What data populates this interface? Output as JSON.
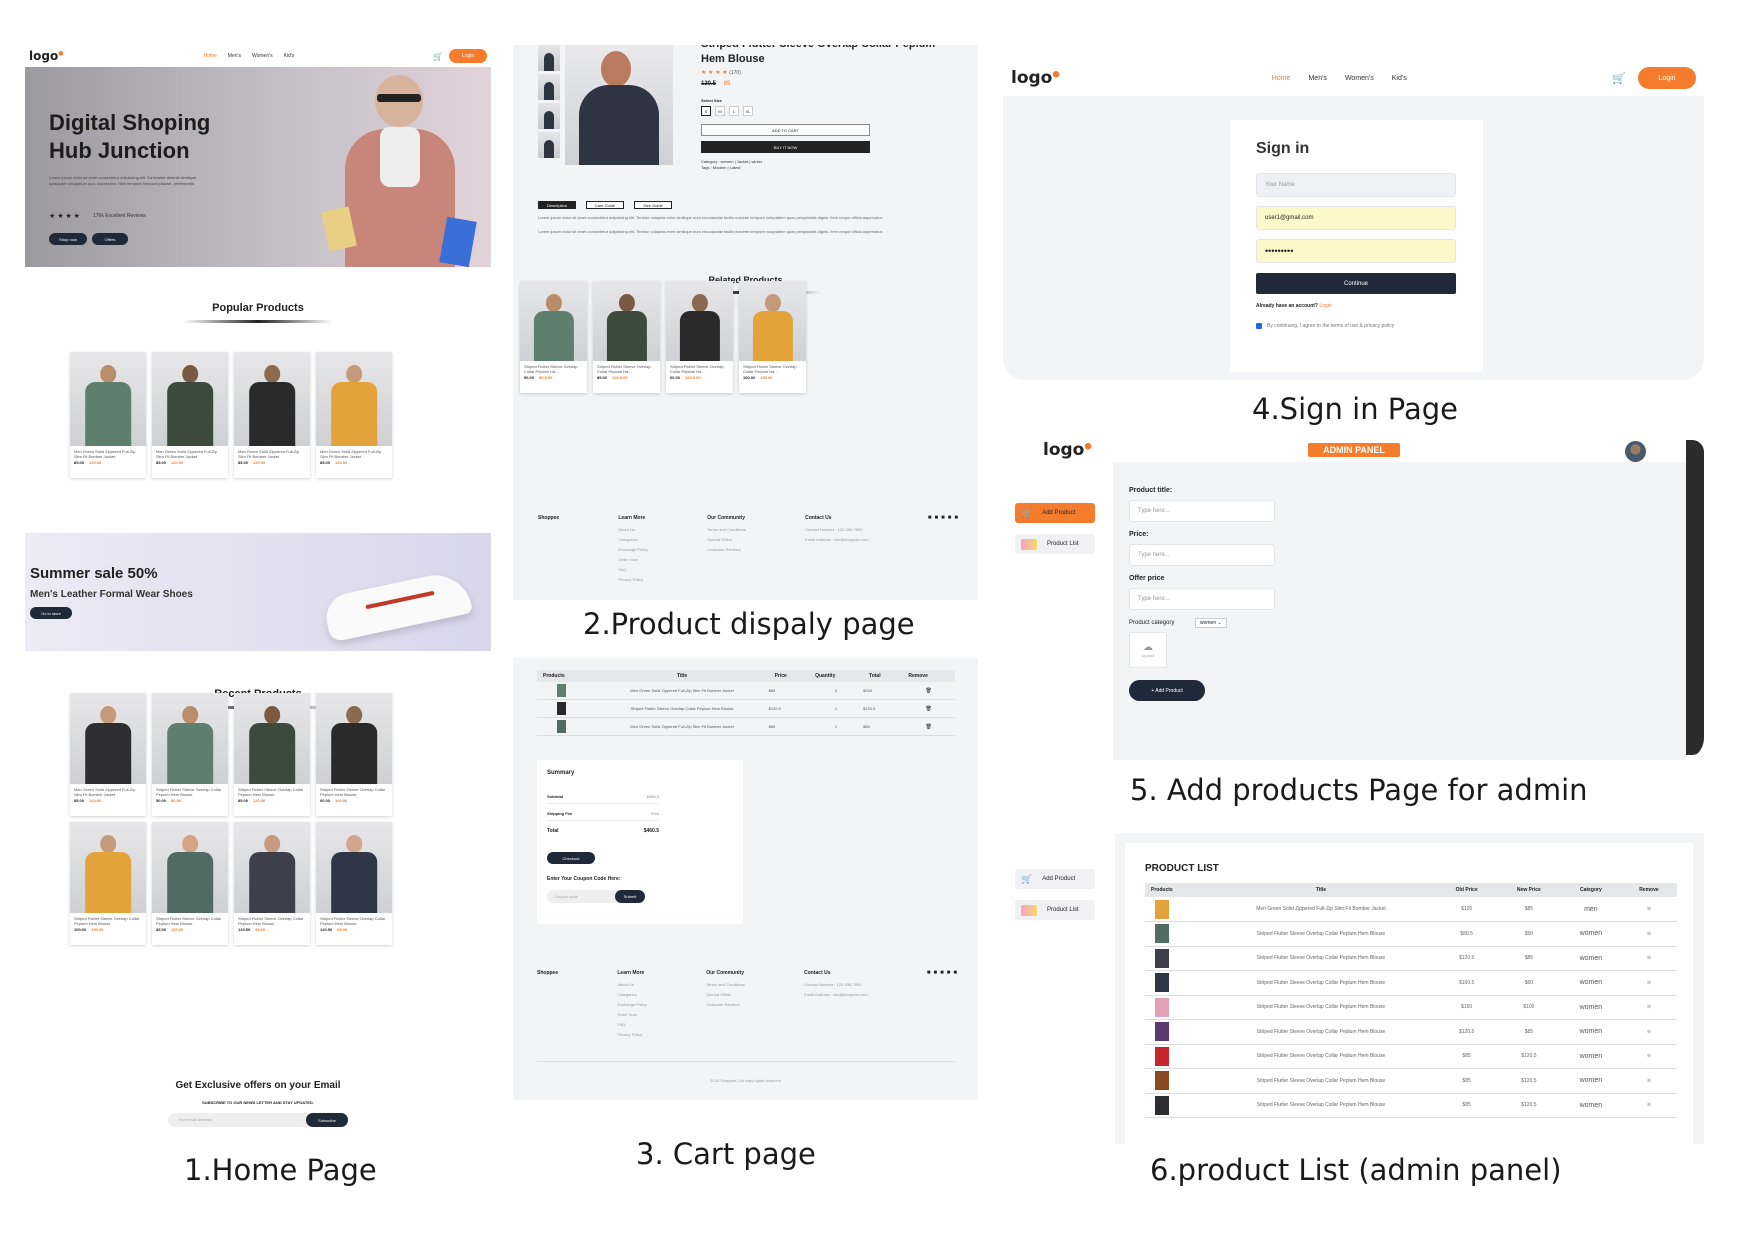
{
  "captions": {
    "home": "1.Home Page",
    "product": "2.Product dispaly page",
    "cart": "3. Cart page",
    "signin": "4.Sign in Page",
    "addproduct": "5. Add products Page for admin",
    "productlist": "6.product List (admin panel)"
  },
  "logo": "logo",
  "nav": [
    "Home",
    "Men's",
    "Women's",
    "Kid's"
  ],
  "login": "Login",
  "cart_count": "0",
  "home": {
    "hero_title": "Digital Shoping Hub Junction",
    "hero_text": "Lorem ipsum dolor sit amet consectetur adipisicing elit. Ea tenetur deleniti similique quisquam voluptatum quo, aspernatur. Nihil tempore tempora placeat, perferendis.",
    "reviews": "176k Excellent Reviews",
    "shop_now": "Shop now",
    "offers": "Offers",
    "popular_title": "Popular Products",
    "popular": [
      {
        "name": "Men Green Solid Zippered Full-Zip Slim Fit Bomber Jacket",
        "new": "85.00",
        "old": "120.00"
      },
      {
        "name": "Men Green Solid Zippered Full-Zip Slim Fit Bomber Jacket",
        "new": "85.00",
        "old": "120.00"
      },
      {
        "name": "Men Green Solid Zippered Full-Zip Slim Fit Bomber Jacket",
        "new": "85.00",
        "old": "120.00"
      },
      {
        "name": "Men Green Solid Zippered Full-Zip Slim Fit Bomber Jacket",
        "new": "85.00",
        "old": "120.00"
      }
    ],
    "sale_title": "Summer sale 50%",
    "sale_sub": "Men's Leather Formal Wear Shoes",
    "go_store": "Go to store",
    "recent_title": "Recent Products",
    "recent": [
      {
        "name": "Men Green Solid Zippered Full-Zip Slim Fit Bomber Jacket",
        "new": "85.00",
        "old": "120.00"
      },
      {
        "name": "Striped Flutter Sleeve Overlap Collar Peplum Hem Blouse",
        "new": "50.00",
        "old": "80.00"
      },
      {
        "name": "Striped Flutter Sleeve Overlap Collar Peplum Hem Blouse",
        "new": "85.00",
        "old": "120.50"
      },
      {
        "name": "Striped Flutter Sleeve Overlap Collar Peplum Hem Blouse",
        "new": "60.00",
        "old": "100.50"
      },
      {
        "name": "Striped Flutter Sleeve Overlap Collar Peplum Hem Blouse",
        "new": "100.00",
        "old": "150.00"
      },
      {
        "name": "Striped Flutter Sleeve Overlap Collar Peplum Hem Blouse",
        "new": "85.00",
        "old": "120.00"
      },
      {
        "name": "Striped Flutter Sleeve Overlap Collar Peplum Hem Blouse",
        "new": "120.50",
        "old": "85.00"
      },
      {
        "name": "Striped Flutter Sleeve Overlap Collar Peplum Hem Blouse",
        "new": "120.50",
        "old": "85.00"
      }
    ],
    "newsletter_title": "Get Exclusive offers on your Email",
    "newsletter_sub": "SUBSCRIBE TO OUR NEWS LETTER AND STAY UPDATED.",
    "email_placeholder": "Your email address",
    "subscribe": "Subscribe"
  },
  "product": {
    "title": "Striped Flutter Sleeve Overlap Collar Peplum Hem Blouse",
    "rating_count": "(170)",
    "old_price": "120.5",
    "new_price": "85",
    "select_size": "Select Size",
    "sizes": [
      "S",
      "M",
      "L",
      "XL"
    ],
    "add_to_cart": "ADD TO CART",
    "buy_now": "BUY IT NOW",
    "category": "Category : women | Jacket | winter",
    "tags": "Tags : Modern | Latest",
    "tabs": [
      "Description",
      "Care Guide",
      "Size Guide"
    ],
    "desc": "Lorem ipsum dolor sit amet consectetur adipisicing elit. Tenetur voluptas enim similique eum recusandae facilis maxime tempore voluptatem quos perspiciatis dignis. Item neque officia aspernatur.",
    "related_title": "Related Products",
    "related": [
      {
        "name": "Striped Flutter Sleeve Overlap Collar Peplum Ha...",
        "new": "50.00",
        "old": "80.5.00"
      },
      {
        "name": "Striped Flutter Sleeve Overlap Collar Peplum Ha...",
        "new": "85.00",
        "old": "120.5.00"
      },
      {
        "name": "Striped Flutter Sleeve Overlap Collar Peplum Ha...",
        "new": "60.00",
        "old": "100.5.00"
      },
      {
        "name": "Striped Flutter Sleeve Overlap Collar Peplum Ha...",
        "new": "100.00",
        "old": "150.00"
      }
    ]
  },
  "footer": {
    "brand": "Shoppee",
    "learn": {
      "title": "Learn More",
      "links": [
        "About Us",
        "Categories",
        "Exchange Policy",
        "Order Now",
        "FAQ",
        "Privacy Policy"
      ]
    },
    "community": {
      "title": "Our Community",
      "links": [
        "Terms and Conditions",
        "Special Offers",
        "Customer Reviews"
      ]
    },
    "contact": {
      "title": "Contact Us",
      "phone": "Contact Number : 123-456-7890",
      "email": "Email Address : info@shoppee.com"
    },
    "copyright": "2024 Shoppee | All copy rights reserved"
  },
  "cart": {
    "headers": [
      "Products",
      "Title",
      "Price",
      "Quantity",
      "Total",
      "Remove"
    ],
    "rows": [
      {
        "title": "Men Green Solid Zippered Full-Zip Slim Fit Bomber Jacket",
        "price": "$85",
        "qty": "3",
        "total": "$255"
      },
      {
        "title": "Striped Flutter Sleeve Overlap Collar Peplum Hem Blouse",
        "price": "$120.5",
        "qty": "1",
        "total": "$120.5"
      },
      {
        "title": "Men Green Solid Zippered Full-Zip Slim Fit Bomber Jacket",
        "price": "$85",
        "qty": "1",
        "total": "$85"
      }
    ],
    "summary_title": "Summary",
    "subtotal_label": "Subtotal",
    "subtotal": "$460.5",
    "shipping_label": "Shipping Fee",
    "shipping": "Free",
    "total_label": "Total",
    "total": "$460.5",
    "checkout": "Checkout",
    "coupon_label": "Enter Your Coupon Code Here:",
    "coupon_placeholder": "Coupon code",
    "submit": "Submit"
  },
  "signin": {
    "title": "Sign in",
    "name_placeholder": "Your Name",
    "email": "user1@gmail.com",
    "password": "•••••••••",
    "continue": "Continue",
    "have_account": "Already have an account?",
    "login_link": "Login",
    "agree": "By continuing, I agree to the terms of use & privacy policy"
  },
  "admin": {
    "badge": "ADMIN PANEL",
    "add_product": "Add Product",
    "product_list": "Product List",
    "title_label": "Product title:",
    "price_label": "Price:",
    "offer_label": "Offer price",
    "placeholder": "Type here...",
    "category_label": "Product category",
    "category_value": "women",
    "upload": "Upload",
    "add_button": "+ Add Product"
  },
  "list": {
    "title": "PRODUCT LIST",
    "headers": [
      "Products",
      "Title",
      "Old Price",
      "New Price",
      "Category",
      "Remove"
    ],
    "rows": [
      {
        "title": "Men Green Solid Zippered Full-Zip Slim Fit Bomber Jacket",
        "old": "$120",
        "new": "$85",
        "cat": "men"
      },
      {
        "title": "Striped Flutter Sleeve Overlap Collar Peplum Hem Blouse",
        "old": "$80.5",
        "new": "$50",
        "cat": "women"
      },
      {
        "title": "Striped Flutter Sleeve Overlap Collar Peplum Hem Blouse",
        "old": "$120.5",
        "new": "$85",
        "cat": "women"
      },
      {
        "title": "Striped Flutter Sleeve Overlap Collar Peplum Hem Blouse",
        "old": "$100.5",
        "new": "$60",
        "cat": "women"
      },
      {
        "title": "Striped Flutter Sleeve Overlap Collar Peplum Hem Blouse",
        "old": "$150",
        "new": "$100",
        "cat": "women"
      },
      {
        "title": "Striped Flutter Sleeve Overlap Collar Peplum Hem Blouse",
        "old": "$120.5",
        "new": "$85",
        "cat": "women"
      },
      {
        "title": "Striped Flutter Sleeve Overlap Collar Peplum Hem Blouse",
        "old": "$85",
        "new": "$120.5",
        "cat": "women"
      },
      {
        "title": "Striped Flutter Sleeve Overlap Collar Peplum Hem Blouse",
        "old": "$85",
        "new": "$120.5",
        "cat": "women"
      },
      {
        "title": "Striped Flutter Sleeve Overlap Collar Peplum Hem Blouse",
        "old": "$85",
        "new": "$120.5",
        "cat": "women"
      }
    ]
  },
  "colors": {
    "accent": "#f47c2c",
    "dark": "#1f2937",
    "panel": "#f3f4f6"
  }
}
